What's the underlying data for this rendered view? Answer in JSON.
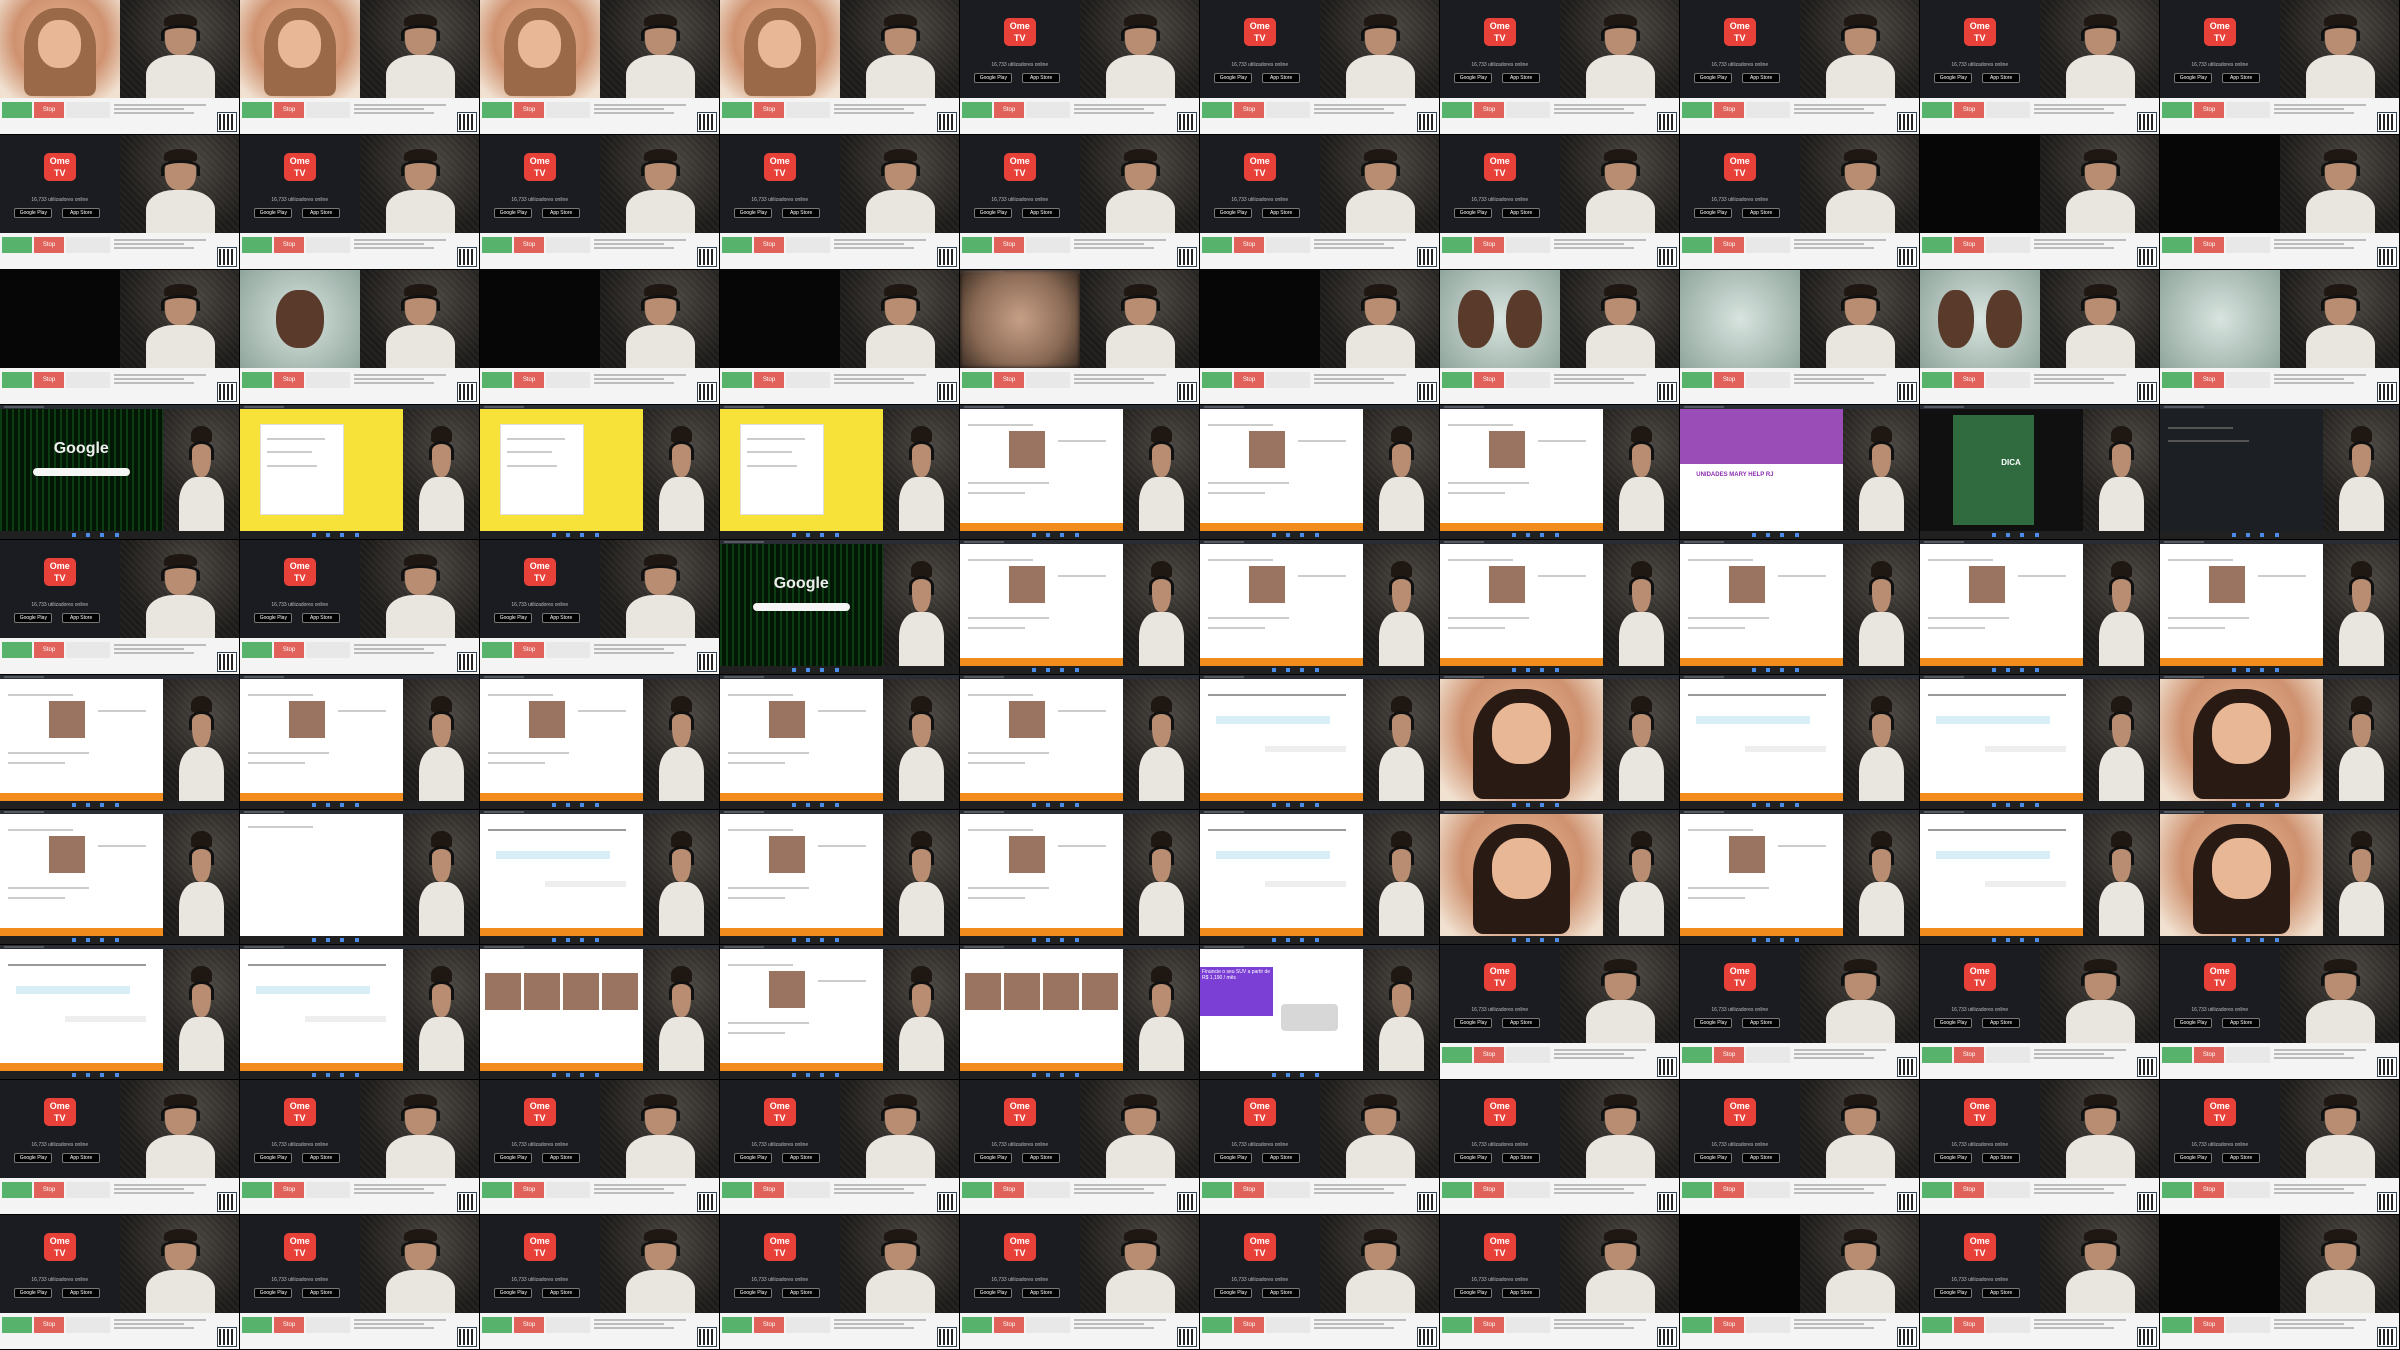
{
  "grid": {
    "columns": 10,
    "rows": 10
  },
  "labels": {
    "ome_logo": "Ome TV",
    "google": "Google",
    "google_play": "Google Play",
    "app_store": "App Store",
    "stop": "Stop",
    "online": "16,733 utilizadores online",
    "promo_heading": "UNIDADES MARY HELP RJ",
    "promo_sub": "DICA",
    "car_ad": "Financie o seu SUV a partir de R$ 1,190 / mês"
  },
  "cells": [
    "girl",
    "girl",
    "girl",
    "girl",
    "ome",
    "ome",
    "ome",
    "ome",
    "ome",
    "ome",
    "ome",
    "ome",
    "ome",
    "ome",
    "ome",
    "ome",
    "ome",
    "ome",
    "dark",
    "dark",
    "dark",
    "face",
    "dark",
    "dark",
    "blur",
    "dark",
    "facepair",
    "light",
    "facepair",
    "light",
    "google",
    "yellow",
    "yellow",
    "yellow",
    "profile",
    "profile",
    "profile",
    "purple",
    "green",
    "dash",
    "ome",
    "ome",
    "ome",
    "google",
    "profile",
    "profile",
    "profile",
    "profile",
    "profile",
    "profile",
    "profile",
    "profile",
    "profile",
    "profile",
    "profile",
    "chat",
    "selfie",
    "chat",
    "chat",
    "selfie",
    "profile",
    "white",
    "chat",
    "profile",
    "profile",
    "chat",
    "selfie",
    "profile",
    "chat",
    "selfie",
    "chat",
    "chat",
    "gallery",
    "profile",
    "gallery",
    "car",
    "ome",
    "ome",
    "ome",
    "ome",
    "ome",
    "ome",
    "ome",
    "ome",
    "ome",
    "ome",
    "ome",
    "ome",
    "ome",
    "ome",
    "ome",
    "ome",
    "ome",
    "ome",
    "ome",
    "ome",
    "ome",
    "dark",
    "ome",
    "dark"
  ]
}
